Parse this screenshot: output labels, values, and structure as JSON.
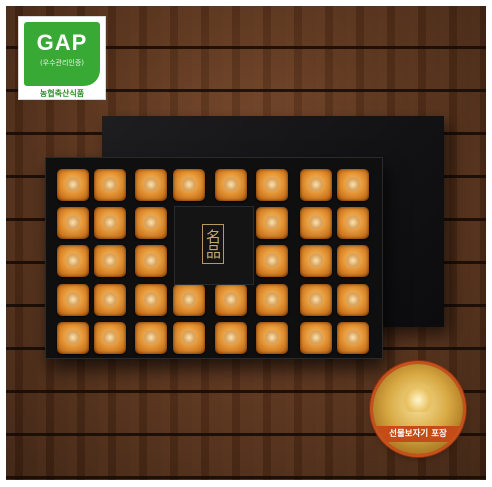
{
  "gap_badge": {
    "title": "GAP",
    "subtitle": "(우수관리인증)",
    "footer": "농협축산식품"
  },
  "box": {
    "center_label": "名品"
  },
  "wrap_badge": {
    "label": "선물보자기 포장"
  },
  "colors": {
    "gap_green": "#39a935",
    "ribbon_orange": "#c64b17",
    "persimmon": "#e79a3a"
  }
}
